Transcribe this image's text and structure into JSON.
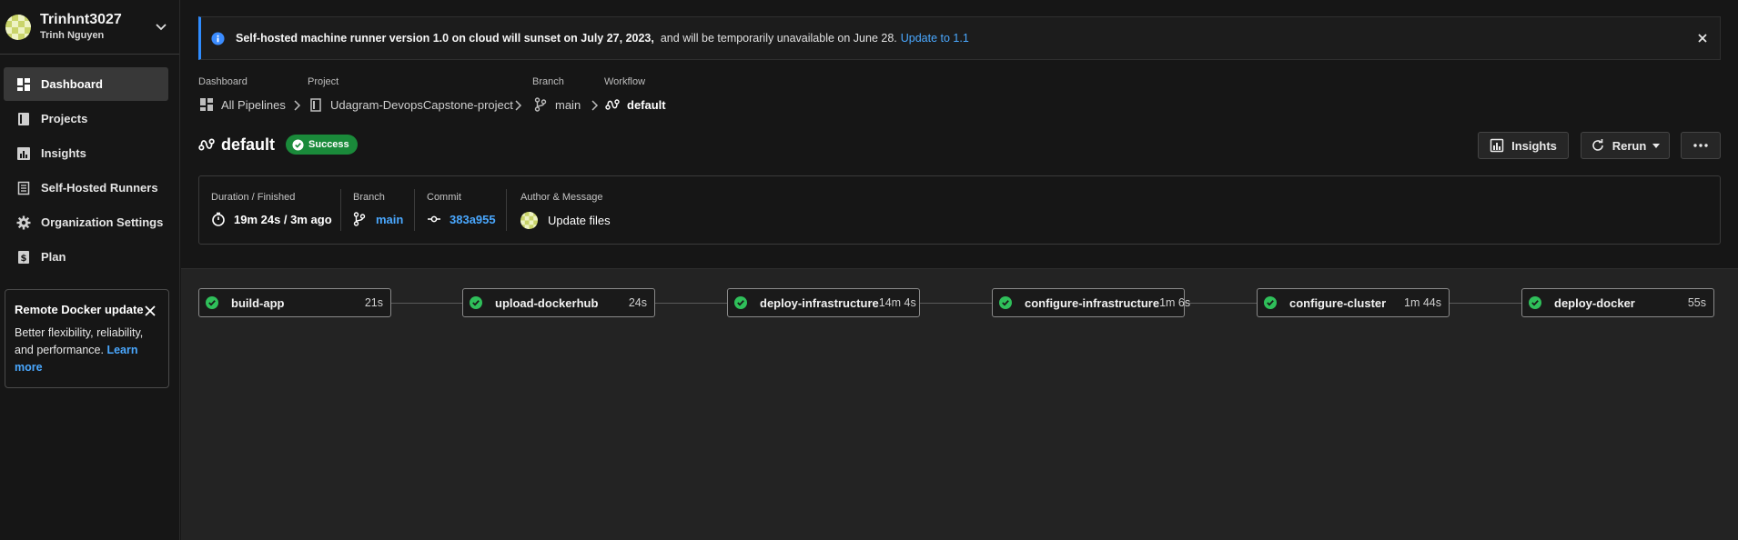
{
  "org": {
    "name": "Trinhnt3027",
    "user": "Trinh Nguyen"
  },
  "nav": {
    "items": [
      {
        "label": "Dashboard",
        "icon": "dashboard-icon",
        "active": true
      },
      {
        "label": "Projects",
        "icon": "book-icon"
      },
      {
        "label": "Insights",
        "icon": "bar-chart-icon"
      },
      {
        "label": "Self-Hosted Runners",
        "icon": "server-icon"
      },
      {
        "label": "Organization Settings",
        "icon": "gear-icon"
      },
      {
        "label": "Plan",
        "icon": "dollar-icon"
      }
    ]
  },
  "promo": {
    "title": "Remote Docker update",
    "body": "Better flexibility, reliability, and performance.",
    "link": "Learn more"
  },
  "banner": {
    "bold": "Self-hosted machine runner version 1.0 on cloud will sunset on July 27, 2023,",
    "normal": "and will be temporarily unavailable on June 28.",
    "link": "Update to 1.1"
  },
  "breadcrumb": {
    "dashboard": {
      "label": "Dashboard",
      "value": "All Pipelines"
    },
    "project": {
      "label": "Project",
      "value": "Udagram-DevopsCapstone-project"
    },
    "branch": {
      "label": "Branch",
      "value": "main"
    },
    "workflow": {
      "label": "Workflow",
      "value": "default"
    }
  },
  "workflow": {
    "title": "default",
    "status": "Success",
    "status_color": "#1a8a3a"
  },
  "actions": {
    "insights": "Insights",
    "rerun": "Rerun"
  },
  "details": {
    "duration": {
      "label": "Duration / Finished",
      "value": "19m 24s / 3m ago"
    },
    "branch": {
      "label": "Branch",
      "value": "main"
    },
    "commit": {
      "label": "Commit",
      "value": "383a955"
    },
    "author": {
      "label": "Author & Message",
      "value": "Update files"
    }
  },
  "jobs": [
    {
      "name": "build-app",
      "duration": "21s",
      "status": "success"
    },
    {
      "name": "upload-dockerhub",
      "duration": "24s",
      "status": "success"
    },
    {
      "name": "deploy-infrastructure",
      "duration": "14m 4s",
      "status": "success"
    },
    {
      "name": "configure-infrastructure",
      "duration": "1m 6s",
      "status": "success"
    },
    {
      "name": "configure-cluster",
      "duration": "1m 44s",
      "status": "success"
    },
    {
      "name": "deploy-docker",
      "duration": "55s",
      "status": "success"
    }
  ],
  "colors": {
    "accent": "#4aa8ff",
    "success": "#2fbf5a",
    "banner_border": "#2f8cff"
  }
}
